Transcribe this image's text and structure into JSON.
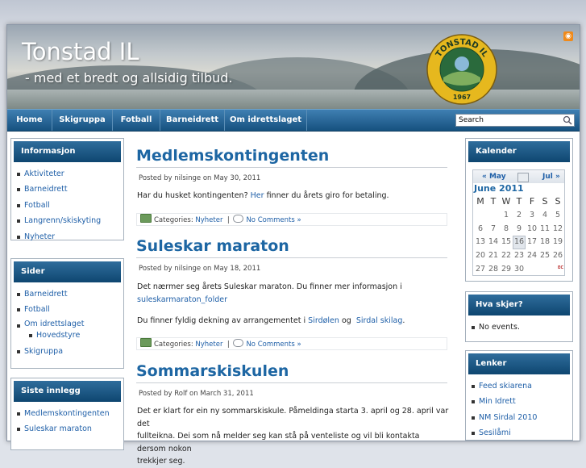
{
  "header": {
    "title": "Tonstad IL",
    "tagline": "- med et bredt og allsidig tilbud.",
    "logo_text": "TONSTAD IL",
    "logo_year": "1967",
    "rss_icon": "rss-icon"
  },
  "nav": {
    "items": [
      "Home",
      "Skigruppa",
      "Fotball",
      "Barneidrett",
      "Om idrettslaget"
    ],
    "search_value": "Search"
  },
  "sidebar_left": {
    "informasjon": {
      "title": "Informasjon",
      "items": [
        "Aktiviteter",
        "Barneidrett",
        "Fotball",
        "Langrenn/skiskyting",
        "Nyheter"
      ]
    },
    "sider": {
      "title": "Sider",
      "items": [
        "Barneidrett",
        "Fotball",
        "Om idrettslaget"
      ],
      "subitem": "Hovedstyre",
      "last": "Skigruppa"
    },
    "siste": {
      "title": "Siste innlegg",
      "items": [
        "Medlemskontingenten",
        "Suleskar maraton"
      ]
    }
  },
  "posts": [
    {
      "title": "Medlemskontingenten",
      "meta": "Posted by nilsinge on May 30, 2011",
      "text_before": "Har du husket kontingenten? ",
      "link": "Her",
      "text_after": " finner du årets giro for betaling.",
      "categories_label": "Categories: ",
      "category": "Nyheter",
      "separator": "|",
      "comments": "No Comments »"
    },
    {
      "title": "Suleskar maraton",
      "meta": "Posted by nilsinge on May 18, 2011",
      "text1": "Det nærmer seg årets Suleskar maraton. Du finner mer informasjon i",
      "link1": "suleskarmaraton_folder",
      "text2": "Du finner fyldig dekning av arrangementet i ",
      "link2": "Sirdølen",
      "text2b": " og  ",
      "link3": "Sirdal skilag",
      "text2c": ".",
      "categories_label": "Categories: ",
      "category": "Nyheter",
      "separator": "|",
      "comments": "No Comments »"
    },
    {
      "title": "Sommarskiskulen",
      "meta": "Posted by Rolf on March 31, 2011",
      "line1": "Det er klart for ein ny sommarskiskule. Påmeldinga starta 3. april og 28. april var det",
      "line2": "fullteikna. Dei som nå melder seg kan stå på venteliste og vil bli kontakta dersom nokon",
      "line3": "trekkjer seg."
    }
  ],
  "sidebar_right": {
    "kalender": {
      "title": "Kalender",
      "prev": "« May",
      "next": "Jul »",
      "month": "June 2011",
      "weekdays": [
        "M",
        "T",
        "W",
        "T",
        "F",
        "S",
        "S"
      ],
      "days": [
        "",
        "",
        "1",
        "2",
        "3",
        "4",
        "5",
        "6",
        "7",
        "8",
        "9",
        "10",
        "11",
        "12",
        "13",
        "14",
        "15",
        "16",
        "17",
        "18",
        "19",
        "20",
        "21",
        "22",
        "23",
        "24",
        "25",
        "26",
        "27",
        "28",
        "29",
        "30",
        "",
        "",
        ""
      ],
      "today": "16",
      "badge": "EC"
    },
    "hva": {
      "title": "Hva skjer?",
      "item": "No events."
    },
    "lenker": {
      "title": "Lenker",
      "items": [
        "Feed skiarena",
        "Min Idrett",
        "NM Sirdal 2010",
        "Sesilåmi"
      ]
    }
  }
}
